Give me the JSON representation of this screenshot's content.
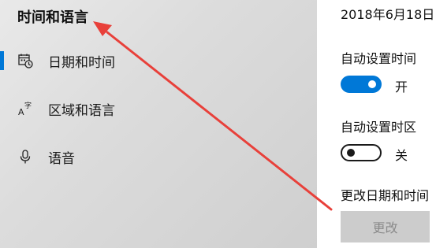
{
  "sidebar": {
    "title": "时间和语言",
    "items": [
      {
        "label": "日期和时间",
        "icon": "calendar-clock-icon",
        "selected": true
      },
      {
        "label": "区域和语言",
        "icon": "language-icon",
        "selected": false
      },
      {
        "label": "语音",
        "icon": "microphone-icon",
        "selected": false
      }
    ]
  },
  "main": {
    "current_date": "2018年6月18日",
    "auto_time": {
      "label": "自动设置时间",
      "state": "开",
      "on": true
    },
    "auto_timezone": {
      "label": "自动设置时区",
      "state": "关",
      "on": false
    },
    "change_section_label": "更改日期和时间",
    "change_button_label": "更改"
  },
  "colors": {
    "accent": "#0078d7",
    "annotation_arrow": "#e8403a"
  }
}
